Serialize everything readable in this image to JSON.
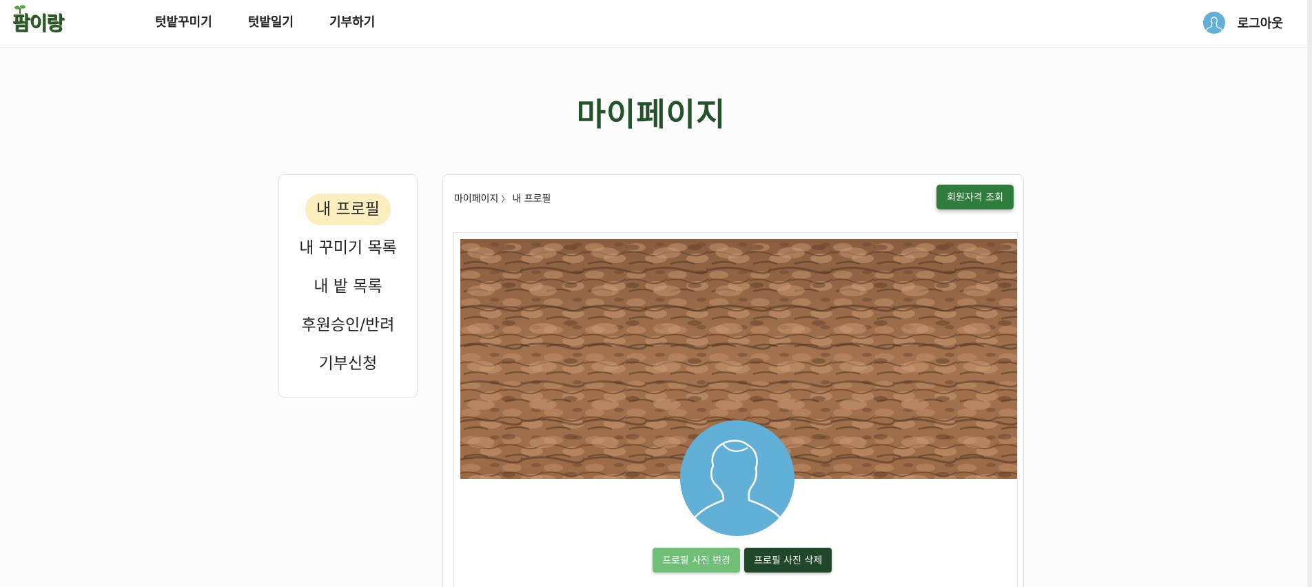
{
  "header": {
    "logo_text": "팜이랑",
    "nav": [
      "텃밭꾸미기",
      "텃밭일기",
      "기부하기"
    ],
    "logout_label": "로그아웃"
  },
  "page": {
    "title": "마이페이지"
  },
  "sidebar": {
    "items": [
      {
        "label": "내 프로필",
        "active": true
      },
      {
        "label": "내 꾸미기 목록",
        "active": false
      },
      {
        "label": "내 밭 목록",
        "active": false
      },
      {
        "label": "후원승인/반려",
        "active": false
      },
      {
        "label": "기부신청",
        "active": false
      }
    ]
  },
  "panel": {
    "breadcrumb": {
      "root": "마이페이지",
      "separator": "〉",
      "current": "내 프로필"
    },
    "membership_button": "회원자격 조회",
    "profile": {
      "change_photo_button": "프로필 사진 변경",
      "delete_photo_button": "프로필 사진 삭제"
    }
  },
  "colors": {
    "brand_green": "#2f7d3c",
    "title_green": "#24522a",
    "active_highlight": "#fcefbf",
    "avatar_blue": "#62b0d8"
  },
  "icons": {
    "logo": "farm-sprout-logo",
    "user_avatar": "person-silhouette-icon"
  }
}
